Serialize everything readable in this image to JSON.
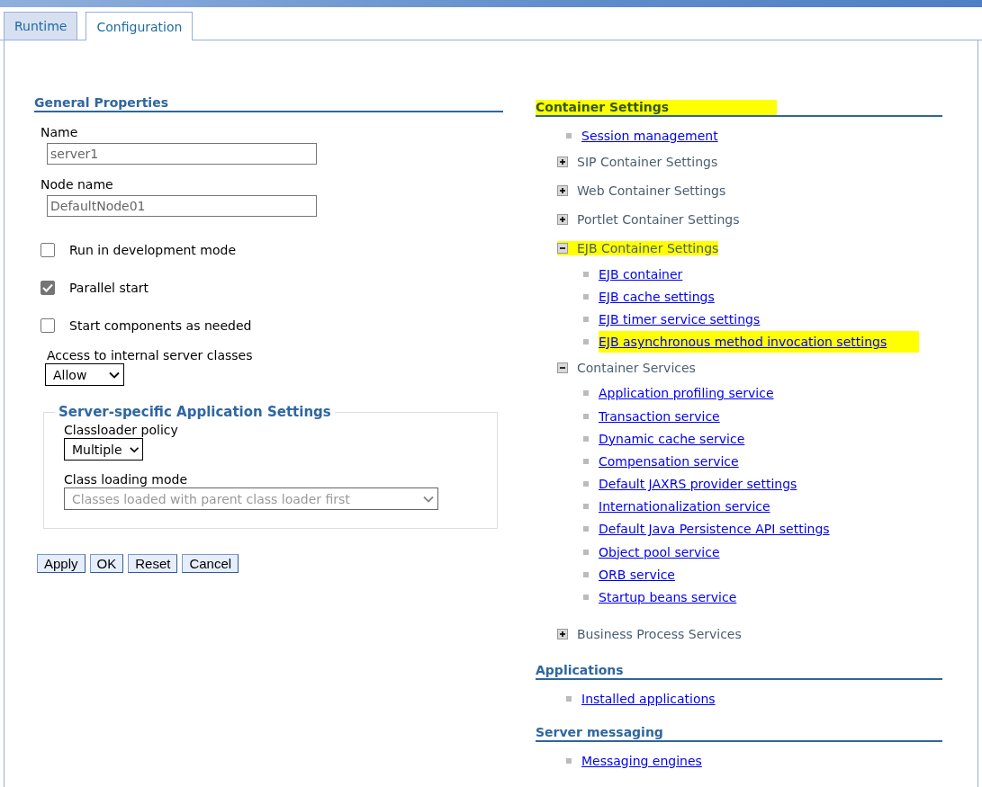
{
  "tabs": [
    {
      "label": "Runtime",
      "selected": false
    },
    {
      "label": "Configuration",
      "selected": true
    }
  ],
  "general_properties": {
    "title": "General Properties",
    "fields": [
      {
        "label": "Name",
        "value": "server1"
      },
      {
        "label": "Node name",
        "value": "DefaultNode01"
      }
    ],
    "checkboxes": [
      {
        "label": "Run in development mode",
        "checked": false
      },
      {
        "label": "Parallel start",
        "checked": true
      },
      {
        "label": "Start components as needed",
        "checked": false
      }
    ],
    "access": {
      "label": "Access to internal server classes",
      "value": "Allow"
    }
  },
  "server_specific": {
    "title": "Server-specific Application Settings",
    "selects": [
      {
        "label": "Classloader policy",
        "value": "Multiple",
        "disabled": false
      },
      {
        "label": "Class loading mode",
        "value": "Classes loaded with parent class loader first",
        "disabled": true
      }
    ]
  },
  "buttons": [
    "Apply",
    "OK",
    "Reset",
    "Cancel"
  ],
  "sections": [
    {
      "title": "Container Settings",
      "highlighted": true,
      "items": [
        {
          "kind": "link",
          "label": "Session management",
          "highlighted": false
        },
        {
          "kind": "group",
          "label": "SIP Container Settings",
          "expanded": false,
          "highlighted": false
        },
        {
          "kind": "group",
          "label": "Web Container Settings",
          "expanded": false,
          "highlighted": false
        },
        {
          "kind": "group",
          "label": "Portlet Container Settings",
          "expanded": false,
          "highlighted": false
        },
        {
          "kind": "group",
          "label": "EJB Container Settings",
          "expanded": true,
          "highlighted": true,
          "children": [
            {
              "label": "EJB container",
              "highlighted": false
            },
            {
              "label": "EJB cache settings",
              "highlighted": false
            },
            {
              "label": "EJB timer service settings",
              "highlighted": false
            },
            {
              "label": "EJB asynchronous method invocation settings",
              "highlighted": true
            }
          ]
        },
        {
          "kind": "group",
          "label": "Container Services",
          "expanded": true,
          "highlighted": false,
          "children": [
            {
              "label": "Application profiling service",
              "highlighted": false
            },
            {
              "label": "Transaction service",
              "highlighted": false
            },
            {
              "label": "Dynamic cache service",
              "highlighted": false
            },
            {
              "label": "Compensation service",
              "highlighted": false
            },
            {
              "label": "Default JAXRS provider settings",
              "highlighted": false
            },
            {
              "label": "Internationalization service",
              "highlighted": false
            },
            {
              "label": "Default Java Persistence API settings",
              "highlighted": false
            },
            {
              "label": "Object pool service",
              "highlighted": false
            },
            {
              "label": "ORB service",
              "highlighted": false
            },
            {
              "label": "Startup beans service",
              "highlighted": false
            }
          ]
        },
        {
          "kind": "group",
          "label": "Business Process Services",
          "expanded": false,
          "highlighted": false
        }
      ]
    },
    {
      "title": "Applications",
      "highlighted": false,
      "items": [
        {
          "kind": "link",
          "label": "Installed applications",
          "highlighted": false
        }
      ]
    },
    {
      "title": "Server messaging",
      "highlighted": false,
      "items": [
        {
          "kind": "link",
          "label": "Messaging engines",
          "highlighted": false
        }
      ]
    }
  ]
}
